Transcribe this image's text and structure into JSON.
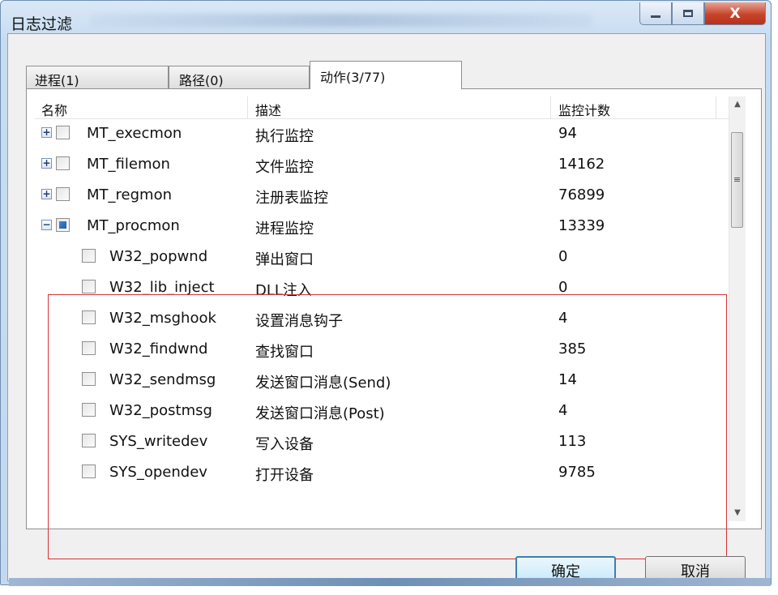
{
  "window": {
    "title": "日志过滤",
    "close_glyph": "X"
  },
  "tabs": [
    {
      "label": "进程(1)"
    },
    {
      "label": "路径(0)"
    },
    {
      "label": "动作(3/77)"
    }
  ],
  "columns": {
    "name": "名称",
    "desc": "描述",
    "count": "监控计数"
  },
  "rows": [
    {
      "name": "MT_execmon",
      "desc": "执行监控",
      "count": "94",
      "expander": "+",
      "checked": false
    },
    {
      "name": "MT_filemon",
      "desc": "文件监控",
      "count": "14162",
      "expander": "+",
      "checked": false
    },
    {
      "name": "MT_regmon",
      "desc": "注册表监控",
      "count": "76899",
      "expander": "+",
      "checked": false
    },
    {
      "name": "MT_procmon",
      "desc": "进程监控",
      "count": "13339",
      "expander": "−",
      "checked": true
    },
    {
      "name": "W32_popwnd",
      "desc": "弹出窗口",
      "count": "0",
      "checked": false
    },
    {
      "name": "W32_lib_inject",
      "desc": "DLL注入",
      "count": "0",
      "checked": false
    },
    {
      "name": "W32_msghook",
      "desc": "设置消息钩子",
      "count": "4",
      "checked": false
    },
    {
      "name": "W32_findwnd",
      "desc": "查找窗口",
      "count": "385",
      "checked": false
    },
    {
      "name": "W32_sendmsg",
      "desc": "发送窗口消息(Send)",
      "count": "14",
      "checked": false
    },
    {
      "name": "W32_postmsg",
      "desc": "发送窗口消息(Post)",
      "count": "4",
      "checked": false
    },
    {
      "name": "SYS_writedev",
      "desc": "写入设备",
      "count": "113",
      "checked": false
    },
    {
      "name": "SYS_opendev",
      "desc": "打开设备",
      "count": "9785",
      "checked": false
    }
  ],
  "buttons": {
    "ok": "确定",
    "cancel": "取消"
  },
  "colors": {
    "highlight_border": "#d9323a",
    "accent": "#3c7fb1"
  }
}
